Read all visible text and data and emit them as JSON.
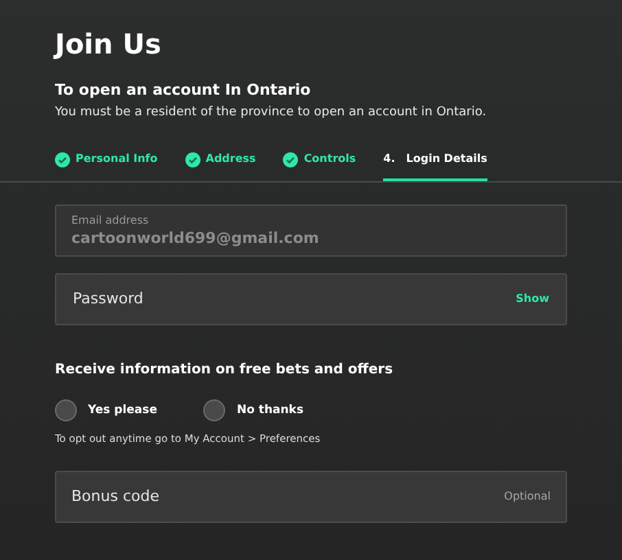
{
  "title": "Join Us",
  "subtitle": "To open an account In Ontario",
  "description": "You must be a resident of the province to open an account in Ontario.",
  "steps": [
    {
      "label": "Personal Info",
      "completed": true,
      "selected": false
    },
    {
      "label": "Address",
      "completed": true,
      "selected": false
    },
    {
      "label": "Controls",
      "completed": true,
      "selected": false
    },
    {
      "number": "4.",
      "label": "Login Details",
      "completed": false,
      "selected": true
    }
  ],
  "email": {
    "label": "Email address",
    "value": "cartoonworld699@gmail.com"
  },
  "password": {
    "placeholder": "Password",
    "action": "Show"
  },
  "offers": {
    "heading": "Receive information on free bets and offers",
    "options": [
      {
        "label": "Yes please",
        "selected": false
      },
      {
        "label": "No thanks",
        "selected": false
      }
    ],
    "note": "To opt out anytime go to My Account > Preferences"
  },
  "bonus": {
    "placeholder": "Bonus code",
    "hint": "Optional"
  }
}
